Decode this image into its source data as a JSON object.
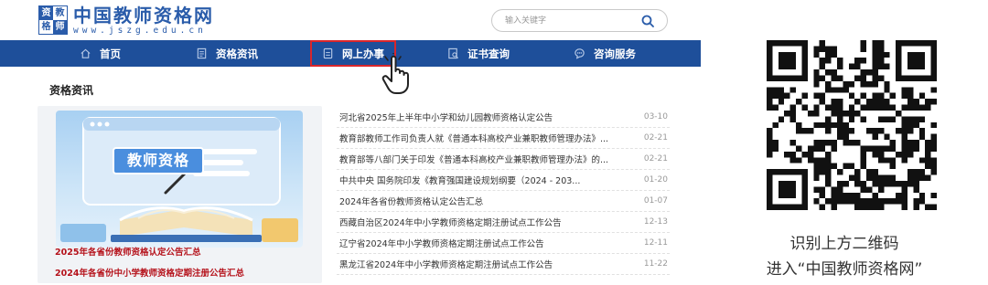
{
  "site": {
    "logo_chars": [
      "资",
      "教",
      "格",
      "师"
    ],
    "title": "中国教师资格网",
    "url": "www.jszg.edu.cn"
  },
  "search": {
    "placeholder": "输入关键字"
  },
  "nav": {
    "items": [
      {
        "label": "首页",
        "icon": "home-icon"
      },
      {
        "label": "资格资讯",
        "icon": "news-icon"
      },
      {
        "label": "网上办事",
        "icon": "document-icon",
        "active": true
      },
      {
        "label": "证书查询",
        "icon": "certificate-search-icon"
      },
      {
        "label": "咨询服务",
        "icon": "chat-icon"
      }
    ],
    "active_color": "#d9262b",
    "bar_color": "#1e4f9a"
  },
  "section": {
    "title": "资格资讯"
  },
  "promo": {
    "card_text": "教师资格",
    "links": [
      "2025年各省份教师资格认定公告汇总",
      "2024年各省份中小学教师资格定期注册公告汇总"
    ]
  },
  "news": [
    {
      "title": "河北省2025年上半年中小学和幼儿园教师资格认定公告",
      "date": "03-10"
    },
    {
      "title": "教育部教师工作司负责人就《普通本科高校产业兼职教师管理办法》...",
      "date": "02-21"
    },
    {
      "title": "教育部等八部门关于印发《普通本科高校产业兼职教师管理办法》的...",
      "date": "02-21"
    },
    {
      "title": "中共中央 国务院印发《教育强国建设规划纲要（2024 - 203...",
      "date": "01-20"
    },
    {
      "title": "2024年各省份教师资格认定公告汇总",
      "date": "01-07"
    },
    {
      "title": "西藏自治区2024年中小学教师资格定期注册试点工作公告",
      "date": "12-13"
    },
    {
      "title": "辽宁省2024年中小学教师资格定期注册试点工作公告",
      "date": "12-11"
    },
    {
      "title": "黑龙江省2024年中小学教师资格定期注册试点工作公告",
      "date": "11-22"
    }
  ],
  "qr": {
    "caption_line1": "识别上方二维码",
    "caption_line2": "进入“中国教师资格网”"
  }
}
